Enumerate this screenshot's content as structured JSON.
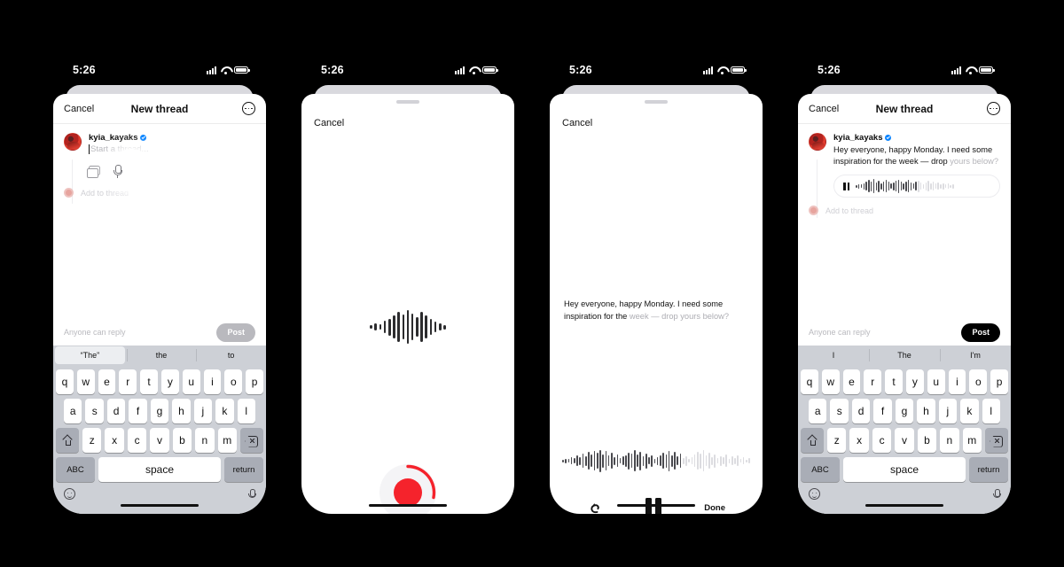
{
  "meta": {
    "background": "#000000",
    "accent_red": "#f5232c",
    "accent_blue": "#0a84ff",
    "text_primary": "#111111",
    "text_dim": "#b4b4b9"
  },
  "status_bar": {
    "time": "5:26",
    "cellular": "signal-icon",
    "wifi": "wifi-icon",
    "battery": "battery-icon"
  },
  "phones": [
    {
      "id": "phone-1-compose",
      "nav": {
        "cancel": "Cancel",
        "title": "New thread",
        "more": "more-options-icon"
      },
      "composer": {
        "username": "kyia_kayaks",
        "verified": true,
        "placeholder": "Start a thread...",
        "add_to_thread": "Add to thread",
        "tools": [
          "media-icon",
          "microphone-icon"
        ]
      },
      "footer": {
        "reply": "Anyone can reply",
        "post": "Post",
        "post_enabled": false
      },
      "keyboard": {
        "suggestions": [
          "“The”",
          "the",
          "to"
        ],
        "selected_index": 0,
        "row1": [
          "q",
          "w",
          "e",
          "r",
          "t",
          "y",
          "u",
          "i",
          "o",
          "p"
        ],
        "row2": [
          "a",
          "s",
          "d",
          "f",
          "g",
          "h",
          "j",
          "k",
          "l"
        ],
        "row3": [
          "z",
          "x",
          "c",
          "v",
          "b",
          "n",
          "m"
        ],
        "shift": "shift-icon",
        "delete": "delete-icon",
        "abc": "ABC",
        "space": "space",
        "return": "return",
        "emoji": "emoji-icon",
        "dictation": "dictation-icon"
      }
    },
    {
      "id": "phone-2-recording",
      "nav": {
        "cancel": "Cancel"
      },
      "waveform_bars": [
        4,
        8,
        6,
        14,
        19,
        26,
        34,
        28,
        38,
        30,
        22,
        34,
        26,
        18,
        12,
        8,
        5
      ],
      "record": {
        "button": "record-button",
        "progress_pct": 28,
        "dot_color": "#f5232c"
      }
    },
    {
      "id": "phone-3-playback",
      "nav": {
        "cancel": "Cancel"
      },
      "transcript": {
        "spoken": "Hey everyone, happy Monday. I need some inspiration for the ",
        "pending": "week — drop yours below?"
      },
      "playback": {
        "progress_pct": 64,
        "bars": [
          3,
          5,
          4,
          8,
          6,
          12,
          9,
          16,
          11,
          20,
          14,
          22,
          18,
          25,
          15,
          22,
          12,
          18,
          9,
          14,
          6,
          10,
          13,
          19,
          16,
          24,
          14,
          21,
          11,
          17,
          8,
          13,
          5,
          9,
          12,
          18,
          15,
          23,
          13,
          20,
          10,
          16,
          7,
          11,
          4,
          8,
          14,
          20,
          17,
          24,
          12,
          18,
          9,
          15,
          6,
          11,
          8,
          14,
          5,
          10,
          7,
          12,
          4,
          8,
          3,
          6
        ]
      },
      "controls": {
        "undo": "undo-icon",
        "pause": "pause-button",
        "done": "Done"
      }
    },
    {
      "id": "phone-4-posted",
      "nav": {
        "cancel": "Cancel",
        "title": "New thread",
        "more": "more-options-icon"
      },
      "composer": {
        "username": "kyia_kayaks",
        "verified": true,
        "post_text_spoken": "Hey everyone, happy Monday. I need some inspiration for the week — drop ",
        "post_text_pending": "yours below?",
        "add_to_thread": "Add to thread"
      },
      "audio_bubble": {
        "state": "pause-button",
        "progress_pct": 62,
        "bars": [
          3,
          5,
          4,
          7,
          10,
          14,
          11,
          16,
          9,
          13,
          7,
          11,
          14,
          10,
          6,
          9,
          12,
          15,
          10,
          7,
          11,
          14,
          9,
          6,
          10,
          13,
          8,
          5,
          9,
          12,
          7,
          10,
          6,
          8,
          5,
          7,
          4,
          6,
          3,
          5
        ]
      },
      "footer": {
        "reply": "Anyone can reply",
        "post": "Post",
        "post_enabled": true
      },
      "keyboard": {
        "suggestions": [
          "I",
          "The",
          "I'm"
        ],
        "selected_index": -1,
        "row1": [
          "q",
          "w",
          "e",
          "r",
          "t",
          "y",
          "u",
          "i",
          "o",
          "p"
        ],
        "row2": [
          "a",
          "s",
          "d",
          "f",
          "g",
          "h",
          "j",
          "k",
          "l"
        ],
        "row3": [
          "z",
          "x",
          "c",
          "v",
          "b",
          "n",
          "m"
        ],
        "shift": "shift-icon",
        "delete": "delete-icon",
        "abc": "ABC",
        "space": "space",
        "return": "return",
        "emoji": "emoji-icon",
        "dictation": "dictation-icon"
      }
    }
  ]
}
